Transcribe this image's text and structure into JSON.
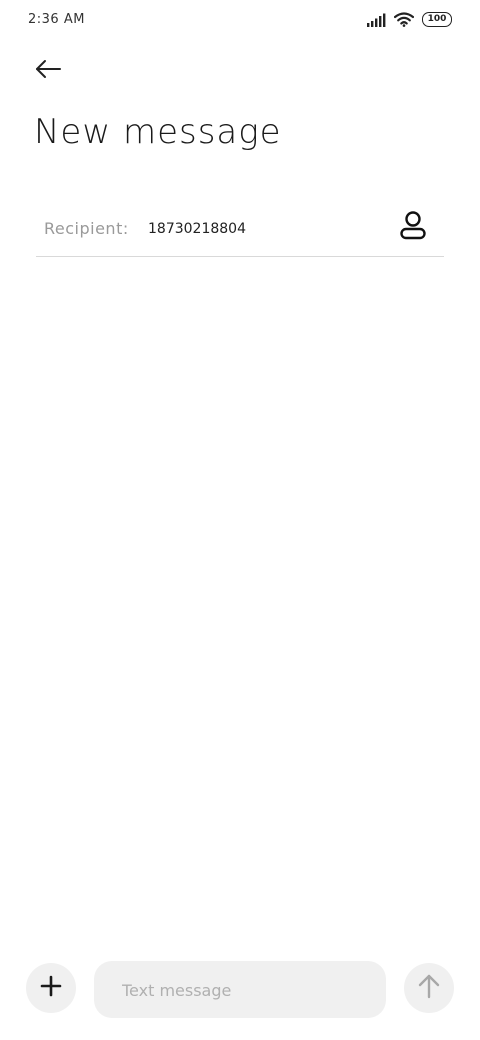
{
  "status_bar": {
    "time": "2:36 AM",
    "battery": "100",
    "signal_icon": "signal-bars-icon",
    "wifi_icon": "wifi-icon"
  },
  "header": {
    "back_icon": "arrow-left-icon",
    "title": "New message"
  },
  "recipient": {
    "label": "Recipient:",
    "value": "18730218804",
    "contact_icon": "person-icon"
  },
  "composer": {
    "attach_icon": "plus-icon",
    "placeholder": "Text message",
    "value": "",
    "send_icon": "arrow-up-icon"
  },
  "colors": {
    "background": "#ffffff",
    "pill_background": "#f0f0f0",
    "text_primary": "#1a1a1a",
    "text_muted": "#9a9a9a",
    "divider": "#d9d9d9"
  }
}
